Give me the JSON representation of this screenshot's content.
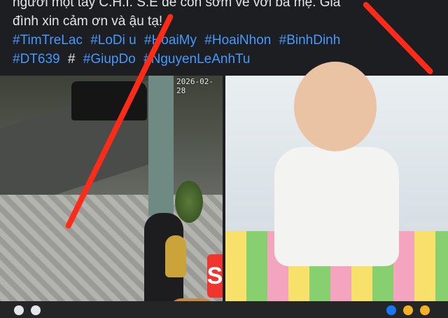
{
  "post": {
    "caption_line1": "người một tay C.H.I.  S.E để con sớm về với ba mẹ. Gia",
    "caption_line2": "đình xin cảm ơn và  ậu tạ!",
    "hashtags_line1": [
      "#TimTreLac",
      "#LoDi u",
      "#HoaiMy",
      "#HoaiNhon",
      "#BinhDinh"
    ],
    "hashtags_line2": [
      "#DT639",
      "#",
      "#GiupDo",
      "#NguyenLeAnhTu"
    ]
  },
  "photos": {
    "left": {
      "timestamp": "2026-02-28"
    },
    "badge_letter": "S"
  },
  "colors": {
    "background": "#1c1e21",
    "hashtag": "#4599ff",
    "annotation": "#ff2a18",
    "badge": "#f0352e"
  }
}
